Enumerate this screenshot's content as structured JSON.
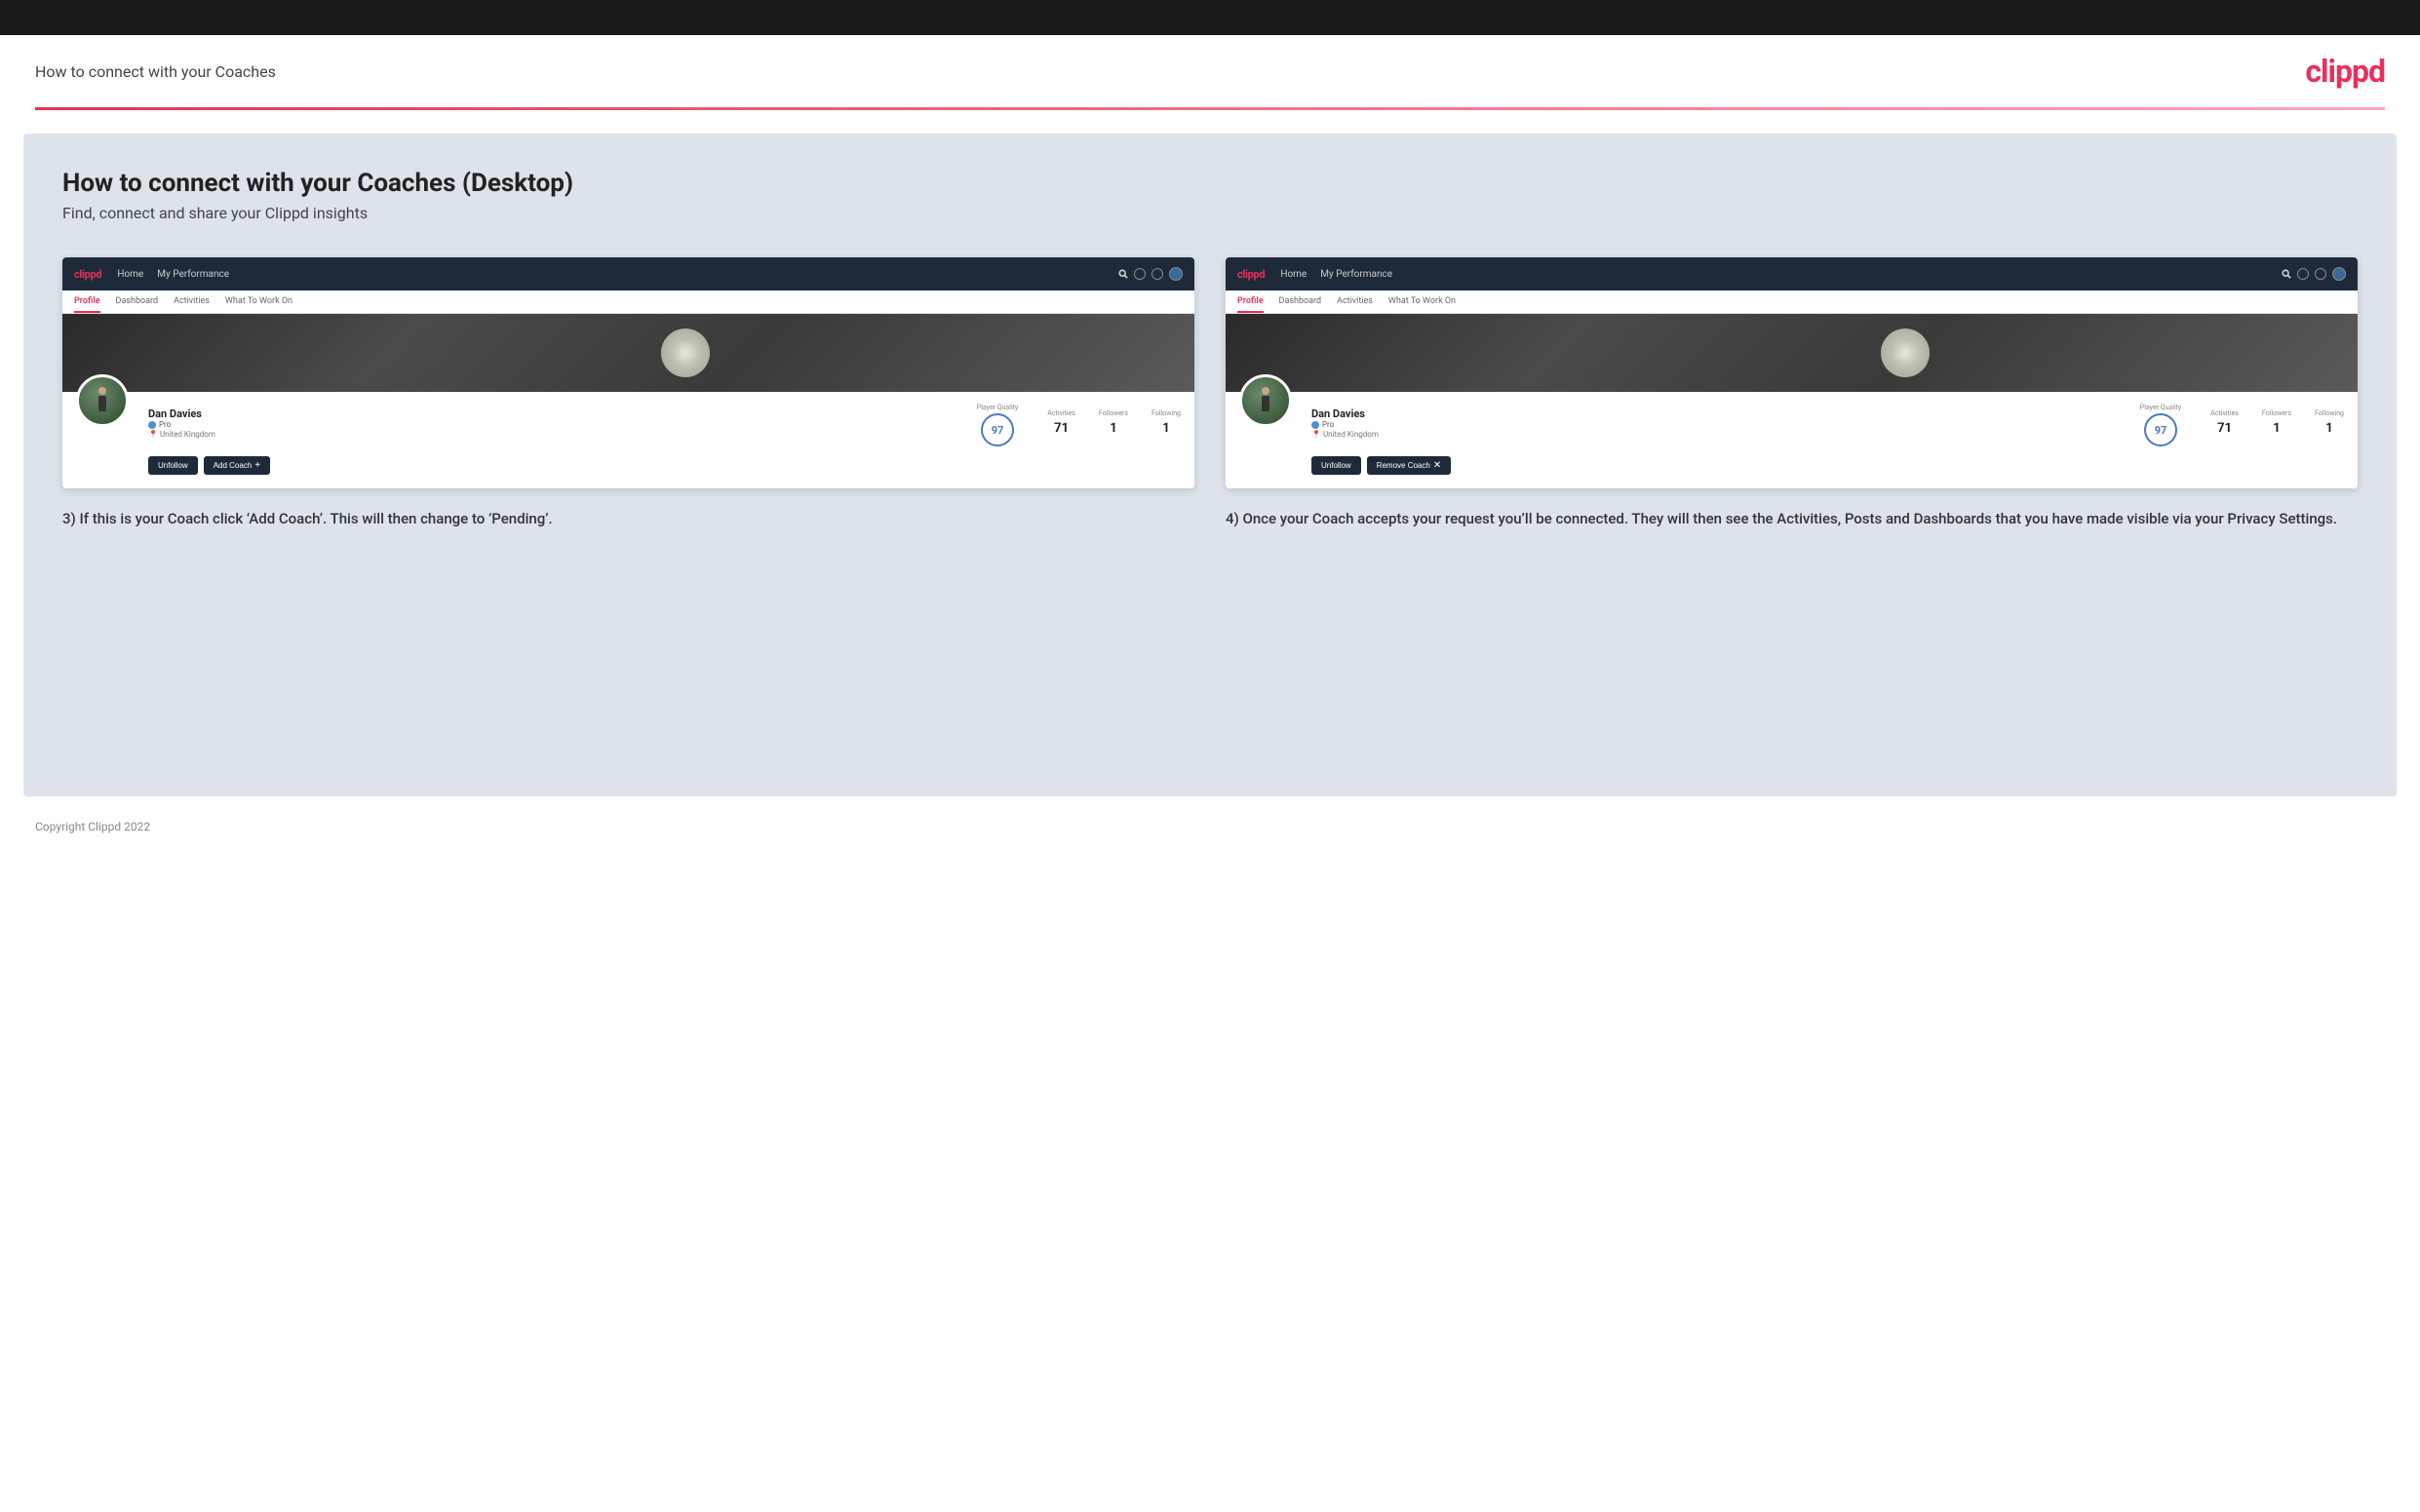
{
  "topBar": {},
  "header": {
    "title": "How to connect with your Coaches",
    "logo": "clippd"
  },
  "main": {
    "title": "How to connect with your Coaches (Desktop)",
    "subtitle": "Find, connect and share your Clippd insights",
    "screenshot1": {
      "nav": {
        "logo": "clippd",
        "links": [
          "Home",
          "My Performance"
        ]
      },
      "tabs": [
        "Profile",
        "Dashboard",
        "Activities",
        "What To Work On"
      ],
      "activeTab": "Profile",
      "profile": {
        "name": "Dan Davies",
        "role": "Pro",
        "location": "United Kingdom",
        "playerQuality": "Player Quality",
        "qualityValue": "97",
        "stats": [
          {
            "label": "Activities",
            "value": "71"
          },
          {
            "label": "Followers",
            "value": "1"
          },
          {
            "label": "Following",
            "value": "1"
          }
        ],
        "buttons": [
          "Unfollow",
          "Add Coach"
        ]
      }
    },
    "screenshot2": {
      "nav": {
        "logo": "clippd",
        "links": [
          "Home",
          "My Performance"
        ]
      },
      "tabs": [
        "Profile",
        "Dashboard",
        "Activities",
        "What To Work On"
      ],
      "activeTab": "Profile",
      "profile": {
        "name": "Dan Davies",
        "role": "Pro",
        "location": "United Kingdom",
        "playerQuality": "Player Quality",
        "qualityValue": "97",
        "stats": [
          {
            "label": "Activities",
            "value": "71"
          },
          {
            "label": "Followers",
            "value": "1"
          },
          {
            "label": "Following",
            "value": "1"
          }
        ],
        "buttons": [
          "Unfollow",
          "Remove Coach"
        ]
      }
    },
    "caption1": "3) If this is your Coach click ‘Add Coach’. This will then change to ‘Pending’.",
    "caption2": "4) Once your Coach accepts your request you’ll be connected. They will then see the Activities, Posts and Dashboards that you have made visible via your Privacy Settings."
  },
  "footer": {
    "text": "Copyright Clippd 2022"
  }
}
